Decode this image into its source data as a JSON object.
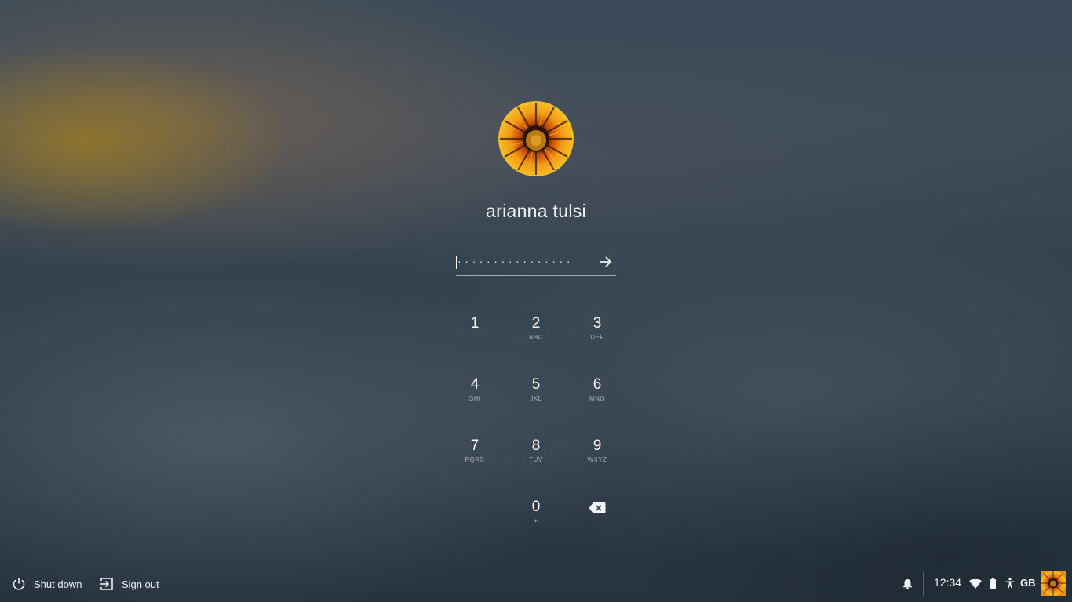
{
  "user": {
    "name": "arianna tulsi",
    "avatar_icon": "gazania-flower-avatar"
  },
  "password": {
    "masked_value": "················",
    "submit_icon": "arrow-right-icon"
  },
  "keypad": {
    "keys": [
      {
        "digit": "1",
        "letters": ""
      },
      {
        "digit": "2",
        "letters": "ABC"
      },
      {
        "digit": "3",
        "letters": "DEF"
      },
      {
        "digit": "4",
        "letters": "GHI"
      },
      {
        "digit": "5",
        "letters": "JKL"
      },
      {
        "digit": "6",
        "letters": "MNO"
      },
      {
        "digit": "7",
        "letters": "PQRS"
      },
      {
        "digit": "8",
        "letters": "TUV"
      },
      {
        "digit": "9",
        "letters": "WXYZ"
      },
      {
        "digit": "0",
        "letters": "+"
      }
    ],
    "backspace_icon": "backspace-icon"
  },
  "shelf": {
    "shutdown_label": "Shut down",
    "signout_label": "Sign out"
  },
  "tray": {
    "time": "12:34",
    "language": "GB",
    "icons": [
      "notification-bell-icon",
      "wifi-icon",
      "battery-icon",
      "accessibility-icon"
    ]
  },
  "colors": {
    "avatar_orange": "#f08a12",
    "avatar_dark": "#3a1a06",
    "avatar_center": "#c9891c"
  }
}
